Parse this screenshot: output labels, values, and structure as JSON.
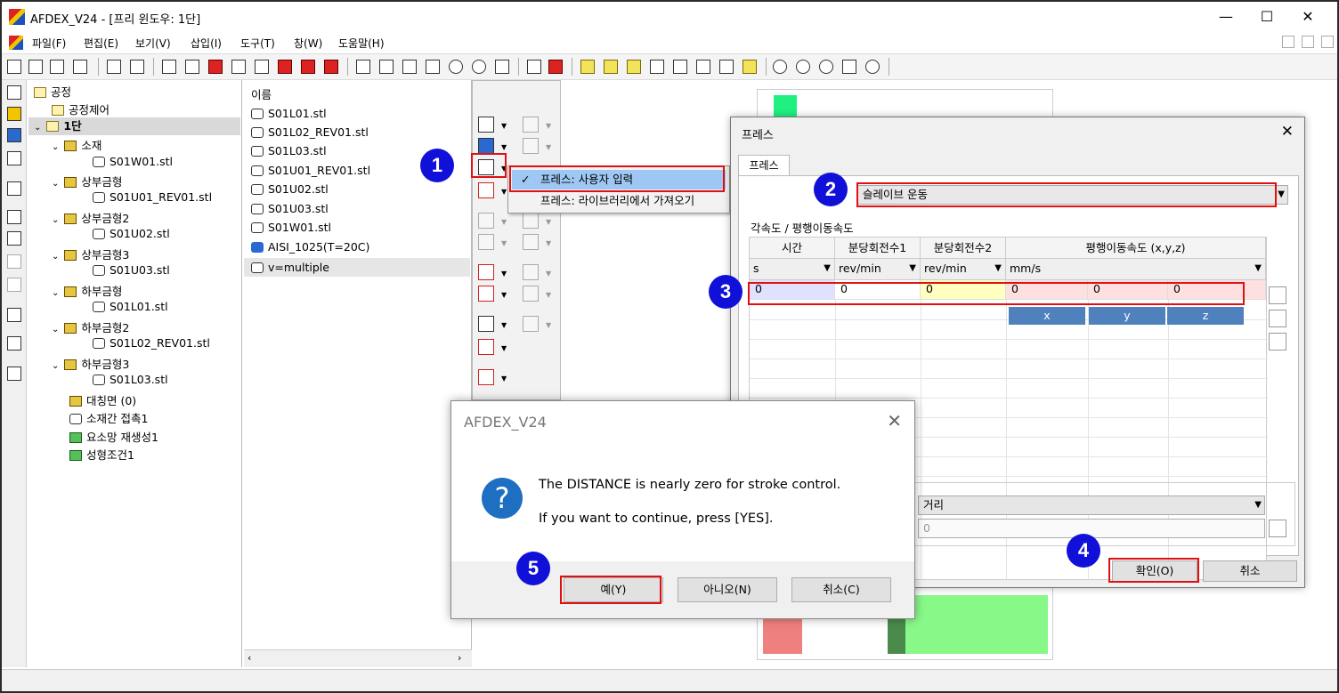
{
  "app": {
    "title": "AFDEX_V24 - [프리 윈도우: 1단]",
    "minimize": "—",
    "maximize": "☐",
    "close": "✕"
  },
  "menu": [
    "파일(F)",
    "편집(E)",
    "보기(V)",
    "삽입(I)",
    "도구(T)",
    "창(W)",
    "도움말(H)"
  ],
  "tree": {
    "root": "공정",
    "process_control": "공정제어",
    "stage": "1단",
    "material": "소재",
    "material_file": "S01W01.stl",
    "upper1": "상부금형",
    "upper1_file": "S01U01_REV01.stl",
    "upper2": "상부금형2",
    "upper2_file": "S01U02.stl",
    "upper3": "상부금형3",
    "upper3_file": "S01U03.stl",
    "lower1": "하부금형",
    "lower1_file": "S01L01.stl",
    "lower2": "하부금형2",
    "lower2_file": "S01L02_REV01.stl",
    "lower3": "하부금형3",
    "lower3_file": "S01L03.stl",
    "symmetry": "대칭면 (0)",
    "contact": "소재간 접촉1",
    "remesh": "요소망 재생성1",
    "condition": "성형조건1"
  },
  "filelist": {
    "header": "이름",
    "items": [
      "S01L01.stl",
      "S01L02_REV01.stl",
      "S01L03.stl",
      "S01U01_REV01.stl",
      "S01U02.stl",
      "S01U03.stl",
      "S01W01.stl",
      "AISI_1025(T=20C)",
      "v=multiple"
    ]
  },
  "context_menu": {
    "check": "✓",
    "item1": "프레스: 사용자 입력",
    "item2": "프레스: 라이브러리에서 가져오기"
  },
  "press_dialog": {
    "title": "프레스",
    "tab": "프레스",
    "type_value": "슬레이브 운동",
    "section": "각속도 / 평행이동속도",
    "columns": [
      "시간",
      "분당회전수1",
      "분당회전수2",
      "평행이동속도 (x,y,z)"
    ],
    "units": [
      "s",
      "rev/min",
      "rev/min",
      "mm/s"
    ],
    "row": [
      "0",
      "0",
      "0",
      "0",
      "0",
      "0"
    ],
    "xyz": [
      "x",
      "y",
      "z"
    ],
    "stroke_select": "거리",
    "stroke_value": "0",
    "ok": "확인(O)",
    "cancel": "취소"
  },
  "alert": {
    "title": "AFDEX_V24",
    "icon": "?",
    "line1": "The DISTANCE is nearly zero for stroke control.",
    "line2": "If you want to continue, press [YES].",
    "yes": "예(Y)",
    "no": "아니오(N)",
    "cancel": "취소(C)"
  },
  "badges": [
    "1",
    "2",
    "3",
    "4",
    "5"
  ],
  "colors": {
    "highlight_red": "#e01010",
    "badge_blue": "#1010d8",
    "xyz_blue": "#4f81bd",
    "menu_selected": "#9ec8f3"
  }
}
